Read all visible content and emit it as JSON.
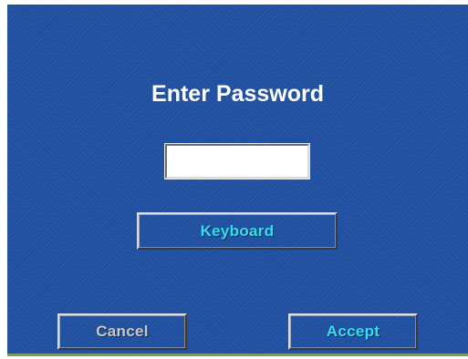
{
  "dialog": {
    "title": "Enter Password",
    "password_value": "",
    "keyboard_label": "Keyboard",
    "cancel_label": "Cancel",
    "accept_label": "Accept"
  },
  "colors": {
    "background": "#1e4ea0",
    "title_text": "#ffffff",
    "active_button_text": "#2fe0f0",
    "disabled_button_text": "#c8c8c8"
  }
}
